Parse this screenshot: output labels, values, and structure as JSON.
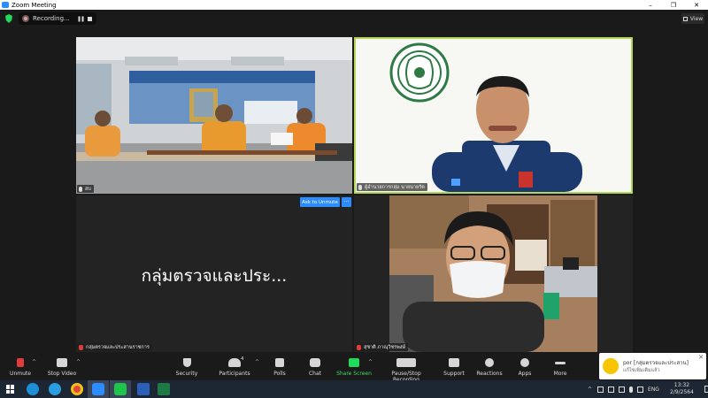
{
  "window": {
    "title": "Zoom Meeting",
    "minimize": "–",
    "maximize": "❐",
    "close": "✕"
  },
  "recording": {
    "label": "Recording...",
    "pause": "❚❚"
  },
  "view_button": {
    "label": "View",
    "icon": "grid-icon"
  },
  "participants": [
    {
      "name": "สบ",
      "muted": false
    },
    {
      "name": "ผู้อำนวยการกลุ่ม นายนายรัต",
      "muted": false
    },
    {
      "name": "กลุ่มตรวจและประสานราชการ",
      "muted": true,
      "avatar_text": "กลุ่มตรวจและประ..."
    },
    {
      "name": "สุชาติ ภาณุวิชรพงษ์",
      "muted": true
    }
  ],
  "ask_to_unmute": {
    "label": "Ask to Unmute",
    "more": "···"
  },
  "toolbar": {
    "unmute": "Unmute",
    "stop_video": "Stop Video",
    "security": "Security",
    "participants": "Participants",
    "participants_count": "4",
    "polls": "Polls",
    "chat": "Chat",
    "share_screen": "Share Screen",
    "pause_recording": "Pause/Stop Recording",
    "support": "Support",
    "reactions": "Reactions",
    "apps": "Apps",
    "more": "More",
    "caret": "^"
  },
  "notification": {
    "title": "por [กลุ่มตรวจและประสาน]",
    "message": "แก้ไขเพิ่มเติมแล้ว",
    "close": "✕"
  },
  "taskbar": {
    "language": "ENG",
    "time": "13:32",
    "date": "2/9/2564",
    "tray_caret": "^"
  },
  "colors": {
    "accent": "#2d8cff",
    "share_green": "#23d959",
    "muted_red": "#e23b3b",
    "active_speaker": "#b4d45a"
  }
}
